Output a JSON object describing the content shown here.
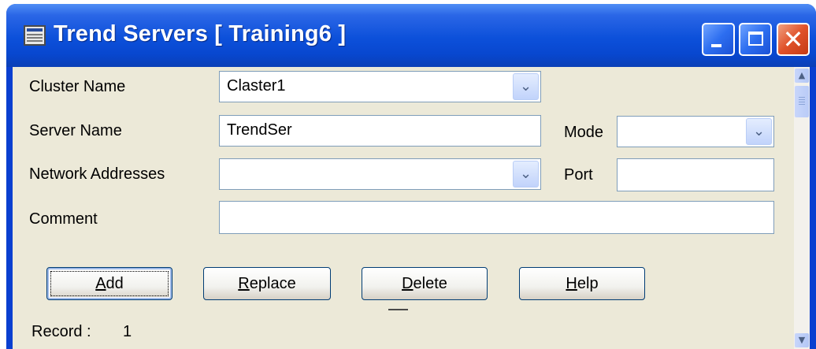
{
  "window": {
    "title": "Trend Servers [ Training6 ]",
    "close_glyph": "✕"
  },
  "form": {
    "cluster_name": {
      "label": "Cluster Name",
      "value": "Claster1"
    },
    "server_name": {
      "label": "Server Name",
      "value": "TrendSer"
    },
    "mode": {
      "label": "Mode",
      "value": ""
    },
    "network_addresses": {
      "label": "Network Addresses",
      "value": ""
    },
    "port": {
      "label": "Port",
      "value": ""
    },
    "comment": {
      "label": "Comment",
      "value": ""
    }
  },
  "buttons": {
    "add": {
      "mnemonic": "A",
      "rest": "dd"
    },
    "replace": {
      "mnemonic": "R",
      "rest": "eplace"
    },
    "delete": {
      "mnemonic": "D",
      "rest": "elete"
    },
    "help": {
      "mnemonic": "H",
      "rest": "elp"
    }
  },
  "status": {
    "record_label": "Record :",
    "record_value": "1"
  },
  "dropdown_glyph": "⌄",
  "icons": [
    "app-window-icon",
    "minimize-icon",
    "maximize-icon",
    "close-icon",
    "chevron-down-icon",
    "scroll-up-icon",
    "scroll-down-icon"
  ],
  "colors": {
    "titlebar": "#0c50da",
    "client": "#ece9d8",
    "close_button": "#e0522a",
    "field_border": "#7f9db9"
  }
}
